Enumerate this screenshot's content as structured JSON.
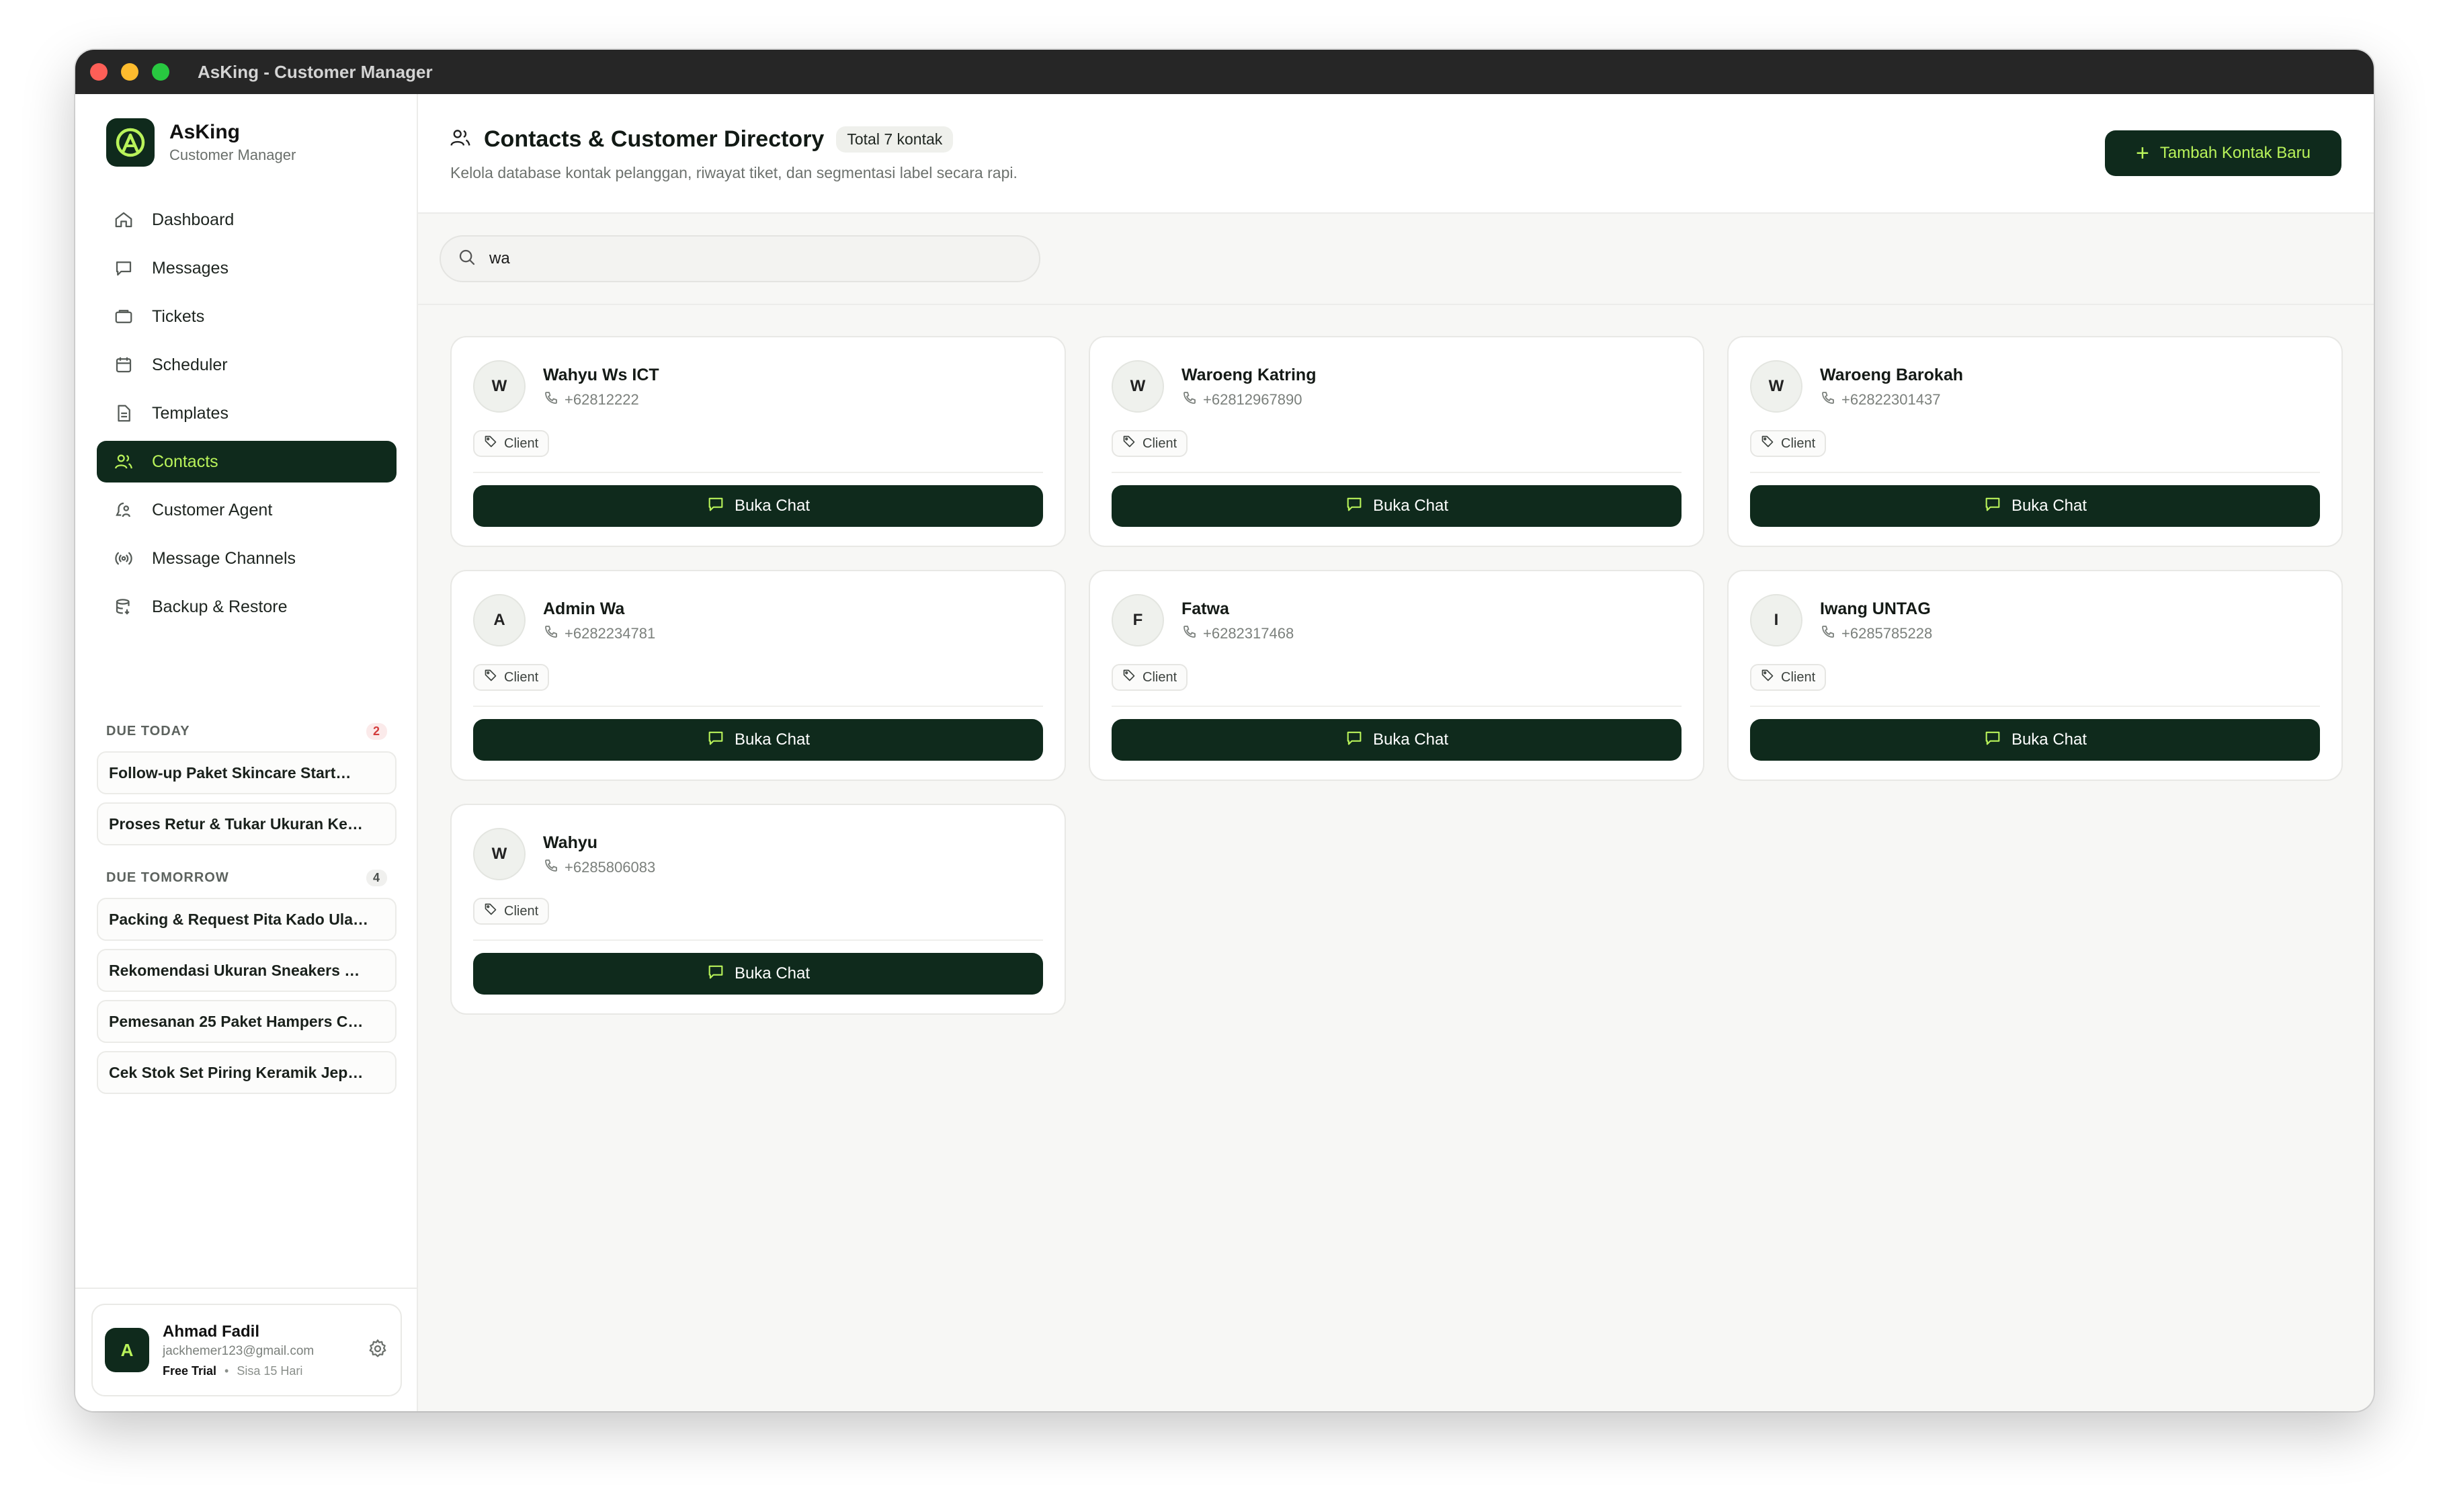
{
  "window": {
    "title": "AsKing - Customer Manager"
  },
  "brand": {
    "name": "AsKing",
    "subtitle": "Customer Manager"
  },
  "nav": [
    {
      "label": "Dashboard",
      "icon": "home-icon"
    },
    {
      "label": "Messages",
      "icon": "message-icon"
    },
    {
      "label": "Tickets",
      "icon": "ticket-icon"
    },
    {
      "label": "Scheduler",
      "icon": "calendar-icon"
    },
    {
      "label": "Templates",
      "icon": "document-icon"
    },
    {
      "label": "Contacts",
      "icon": "users-icon",
      "active": true
    },
    {
      "label": "Customer Agent",
      "icon": "agent-icon"
    },
    {
      "label": "Message Channels",
      "icon": "broadcast-icon"
    },
    {
      "label": "Backup & Restore",
      "icon": "database-icon"
    }
  ],
  "due_today": {
    "label": "DUE TODAY",
    "count": "2",
    "items": [
      "Follow-up Paket Skincare Start…",
      "Proses Retur & Tukar Ukuran Ke…"
    ]
  },
  "due_tomorrow": {
    "label": "DUE TOMORROW",
    "count": "4",
    "items": [
      "Packing & Request Pita Kado Ula…",
      "Rekomendasi Ukuran Sneakers …",
      "Pemesanan 25 Paket Hampers C…",
      "Cek Stok Set Piring Keramik Jep…"
    ]
  },
  "profile": {
    "initial": "A",
    "name": "Ahmad Fadil",
    "email": "jackhemer123@gmail.com",
    "plan": "Free Trial",
    "remaining": "Sisa 15 Hari"
  },
  "header": {
    "title": "Contacts & Customer Directory",
    "count_badge": "Total 7 kontak",
    "subtitle": "Kelola database kontak pelanggan, riwayat tiket, dan segmentasi label secara rapi.",
    "add_button": "Tambah Kontak Baru"
  },
  "search": {
    "value": "wa"
  },
  "colors": {
    "primary": "#0f2a1c",
    "accent": "#b9f35a",
    "background": "#f7f7f5"
  },
  "contacts": [
    {
      "initial": "W",
      "name": "Wahyu Ws ICT",
      "phone": "+62812222",
      "tag": "Client",
      "button": "Buka Chat"
    },
    {
      "initial": "W",
      "name": "Waroeng Katring",
      "phone": "+62812967890",
      "tag": "Client",
      "button": "Buka Chat"
    },
    {
      "initial": "W",
      "name": "Waroeng Barokah",
      "phone": "+62822301437",
      "tag": "Client",
      "button": "Buka Chat"
    },
    {
      "initial": "A",
      "name": "Admin Wa",
      "phone": "+6282234781",
      "tag": "Client",
      "button": "Buka Chat"
    },
    {
      "initial": "F",
      "name": "Fatwa",
      "phone": "+6282317468",
      "tag": "Client",
      "button": "Buka Chat"
    },
    {
      "initial": "I",
      "name": "Iwang UNTAG",
      "phone": "+6285785228",
      "tag": "Client",
      "button": "Buka Chat"
    },
    {
      "initial": "W",
      "name": "Wahyu",
      "phone": "+6285806083",
      "tag": "Client",
      "button": "Buka Chat"
    }
  ]
}
